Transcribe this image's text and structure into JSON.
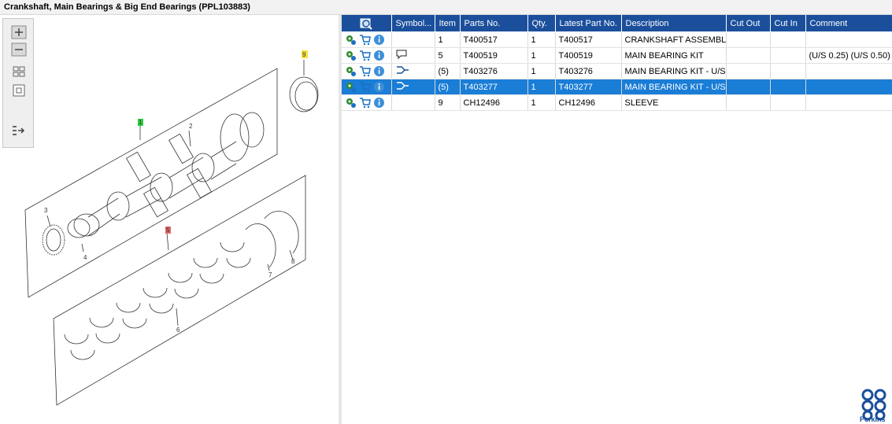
{
  "title": "Crankshaft, Main Bearings & Big End Bearings (PPL103883)",
  "toolbar": {
    "buttons": [
      "zoom-in",
      "zoom-out",
      "fit-grid",
      "actual-size",
      "export-list"
    ]
  },
  "diagram": {
    "callouts": [
      "1",
      "2",
      "3",
      "4",
      "5",
      "6",
      "7",
      "8",
      "9"
    ]
  },
  "table": {
    "headers": [
      "Symbol...",
      "Item",
      "Parts No.",
      "Qty.",
      "Latest Part No.",
      "Description",
      "Cut Out",
      "Cut In",
      "Comment"
    ],
    "rows": [
      {
        "item": "1",
        "part": "T400517",
        "qty": "1",
        "latest": "T400517",
        "desc": "CRANKSHAFT ASSEMBLY",
        "cut_out": "",
        "cut_in": "",
        "comment": "",
        "symbol": ""
      },
      {
        "item": "5",
        "part": "T400519",
        "qty": "1",
        "latest": "T400519",
        "desc": "MAIN BEARING KIT",
        "cut_out": "",
        "cut_in": "",
        "comment": "(U/S 0.25)  (U/S 0.50)",
        "symbol": "comment"
      },
      {
        "item": "(5)",
        "part": "T403276",
        "qty": "1",
        "latest": "T403276",
        "desc": "MAIN BEARING KIT - U/S",
        "cut_out": "",
        "cut_in": "",
        "comment": "",
        "symbol": "alternative"
      },
      {
        "item": "(5)",
        "part": "T403277",
        "qty": "1",
        "latest": "T403277",
        "desc": "MAIN BEARING KIT - U/S",
        "cut_out": "",
        "cut_in": "",
        "comment": "",
        "symbol": "alternative"
      },
      {
        "item": "9",
        "part": "CH12496",
        "qty": "1",
        "latest": "CH12496",
        "desc": "SLEEVE",
        "cut_out": "",
        "cut_in": "",
        "comment": "",
        "symbol": ""
      }
    ]
  },
  "brand": {
    "name": "Perkins",
    "color": "#1b4f9c"
  },
  "colors": {
    "header": "#1b4f9c",
    "selected_row": "#1a7dd6"
  }
}
